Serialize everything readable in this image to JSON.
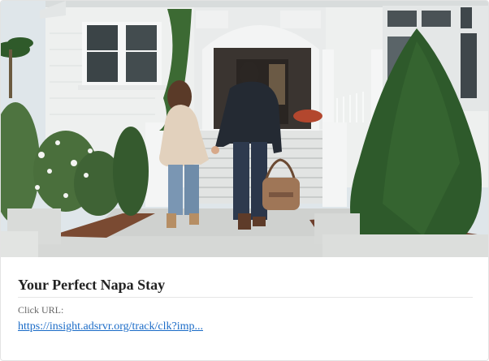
{
  "ad": {
    "title": "Your Perfect Napa Stay",
    "click_url_label": "Click URL:",
    "click_url": "https://insight.adsrvr.org/track/clk?imp..."
  },
  "colors": {
    "title": "#222222",
    "link": "#1a6bc7",
    "label": "#666666"
  }
}
